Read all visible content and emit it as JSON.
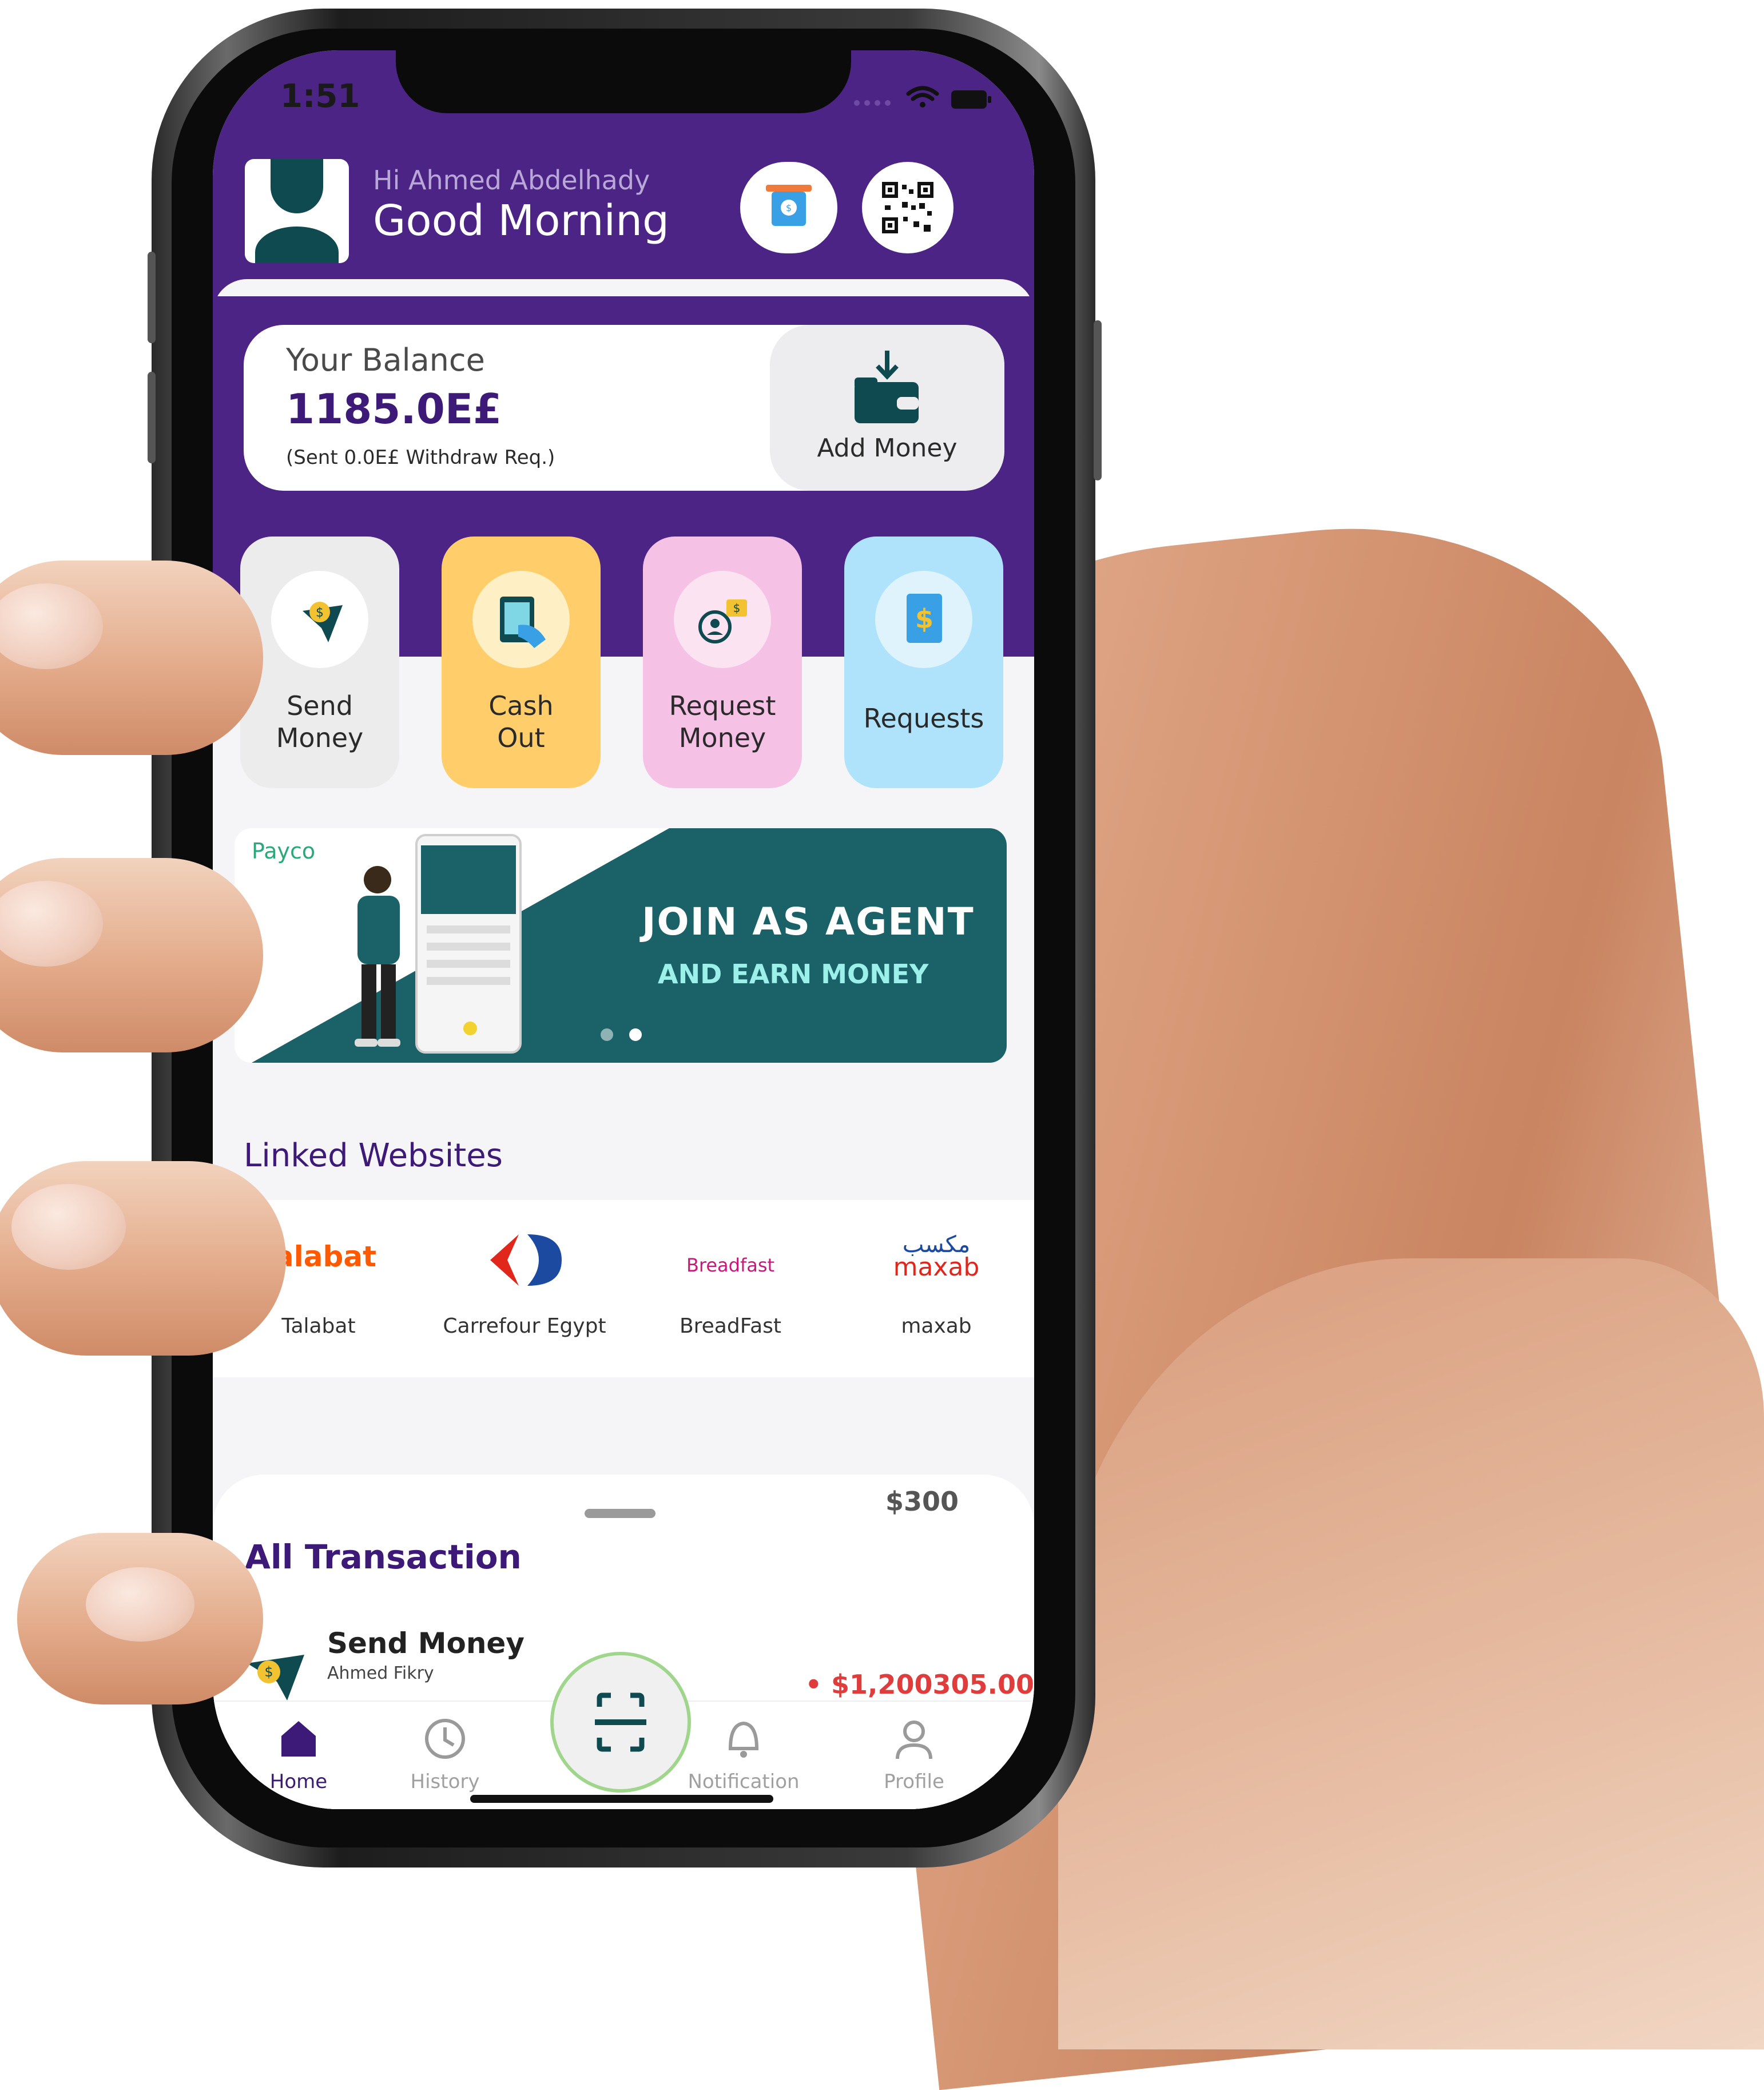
{
  "status": {
    "time": "1:51"
  },
  "header": {
    "greeting_name": "Hi Ahmed Abdelhady",
    "greeting_title": "Good Morning"
  },
  "balance": {
    "label": "Your Balance",
    "value": "1185.0E£",
    "sub": "(Sent 0.0E£ Withdraw Req.)",
    "add_money_label": "Add Money"
  },
  "actions": [
    {
      "label_line1": "Send",
      "label_line2": "Money",
      "color": "#ececec"
    },
    {
      "label_line1": "Cash",
      "label_line2": "Out",
      "color": "#ffce6b"
    },
    {
      "label_line1": "Request",
      "label_line2": "Money",
      "color": "#f5c2e6"
    },
    {
      "label_line1": "Requests",
      "label_line2": "",
      "color": "#aee3fb"
    }
  ],
  "banner": {
    "brand": "Payco",
    "title": "JOIN AS AGENT",
    "subtitle": "AND EARN MONEY"
  },
  "linked": {
    "title": "Linked Websites",
    "sites": [
      {
        "logo_text": "talabat",
        "name": "Talabat"
      },
      {
        "logo_text": "",
        "name": "Carrefour Egypt"
      },
      {
        "logo_text": "Breadfast",
        "name": "BreadFast"
      },
      {
        "logo_text": "maxab",
        "logo_text_ar": "مكسب",
        "name": "maxab"
      }
    ]
  },
  "transactions": {
    "peek_amount": "$300",
    "title": "All Transaction",
    "rows": [
      {
        "title": "Send Money",
        "subtitle": "Ahmed Fikry",
        "amount": "• $1,200305.00"
      }
    ]
  },
  "tabs": [
    {
      "label": "Home",
      "active": true
    },
    {
      "label": "History",
      "active": false
    },
    {
      "label": "Notification",
      "active": false
    },
    {
      "label": "Profile",
      "active": false
    }
  ],
  "colors": {
    "primary": "#4b2486",
    "accent_text": "#3d1a78",
    "banner_teal": "#1b6268",
    "debit_red": "#e03c3c"
  }
}
